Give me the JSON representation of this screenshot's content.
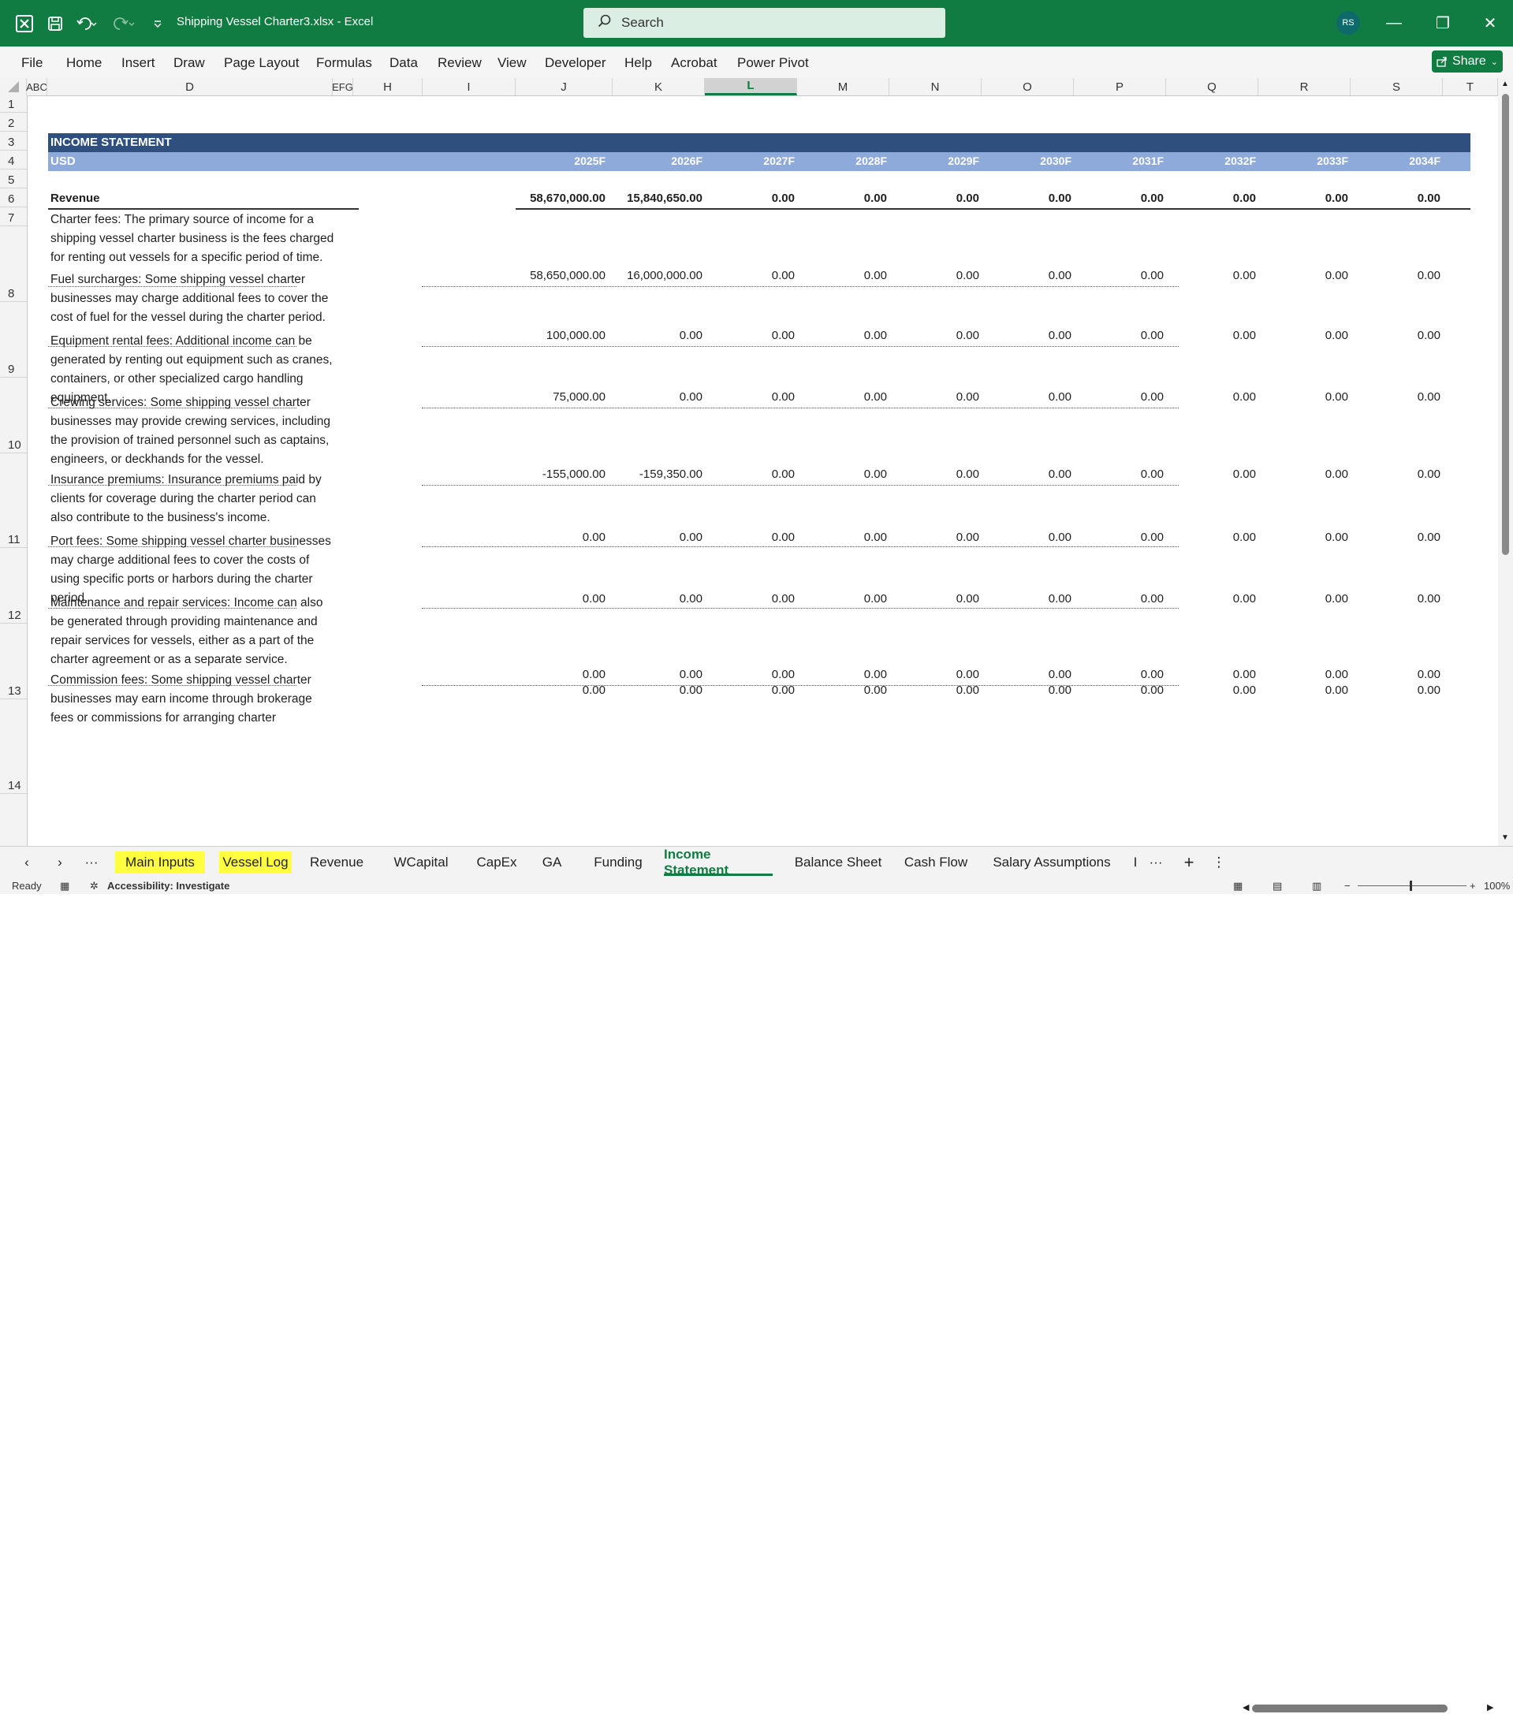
{
  "titlebar": {
    "doc_title": "Shipping Vessel Charter3.xlsx  -  Excel",
    "search_placeholder": "Search",
    "avatar": "RS",
    "minimize": "—",
    "restore": "❐",
    "close": "✕"
  },
  "menu": [
    "File",
    "Home",
    "Insert",
    "Draw",
    "Page Layout",
    "Formulas",
    "Data",
    "Review",
    "View",
    "Developer",
    "Help",
    "Acrobat",
    "Power Pivot"
  ],
  "share_label": "Share",
  "columns": [
    "ABC",
    "D",
    "EFG",
    "H",
    "I",
    "J",
    "K",
    "L",
    "M",
    "N",
    "O",
    "P",
    "Q",
    "R",
    "S",
    "T"
  ],
  "selected_column": "L",
  "rows": [
    "1",
    "2",
    "3",
    "4",
    "5",
    "6",
    "7",
    "8",
    "9",
    "10",
    "11",
    "12",
    "13",
    "14"
  ],
  "sheet": {
    "title": "INCOME STATEMENT",
    "currency": "USD",
    "years": [
      "2025F",
      "2026F",
      "2027F",
      "2028F",
      "2029F",
      "2030F",
      "2031F",
      "2032F",
      "2033F",
      "2034F"
    ],
    "revenue_label": "Revenue",
    "revenue_values": [
      "58,670,000.00",
      "15,840,650.00",
      "0.00",
      "0.00",
      "0.00",
      "0.00",
      "0.00",
      "0.00",
      "0.00",
      "0.00"
    ],
    "lines": [
      {
        "desc": "Charter fees: The primary source of income for a shipping vessel charter business is the fees charged for renting out vessels for a specific period of time.",
        "values": [
          "58,650,000.00",
          "16,000,000.00",
          "0.00",
          "0.00",
          "0.00",
          "0.00",
          "0.00",
          "0.00",
          "0.00",
          "0.00"
        ]
      },
      {
        "desc": "Fuel surcharges: Some shipping vessel charter businesses may charge additional fees to cover the cost of fuel for the vessel during the charter period.",
        "values": [
          "100,000.00",
          "0.00",
          "0.00",
          "0.00",
          "0.00",
          "0.00",
          "0.00",
          "0.00",
          "0.00",
          "0.00"
        ]
      },
      {
        "desc": "Equipment rental fees: Additional income can be generated by renting out equipment such as cranes, containers, or other specialized cargo handling equipment.",
        "values": [
          "75,000.00",
          "0.00",
          "0.00",
          "0.00",
          "0.00",
          "0.00",
          "0.00",
          "0.00",
          "0.00",
          "0.00"
        ]
      },
      {
        "desc": "Crewing services: Some shipping vessel charter businesses may provide crewing services, including the provision of trained personnel such as captains, engineers, or deckhands for the vessel.",
        "values": [
          "-155,000.00",
          "-159,350.00",
          "0.00",
          "0.00",
          "0.00",
          "0.00",
          "0.00",
          "0.00",
          "0.00",
          "0.00"
        ]
      },
      {
        "desc": "Insurance premiums: Insurance premiums paid by clients for coverage during the charter period can also contribute to the business's income.",
        "values": [
          "0.00",
          "0.00",
          "0.00",
          "0.00",
          "0.00",
          "0.00",
          "0.00",
          "0.00",
          "0.00",
          "0.00"
        ]
      },
      {
        "desc": "Port fees: Some shipping vessel charter businesses may charge additional fees to cover the costs of using specific ports or harbors during the charter period.",
        "values": [
          "0.00",
          "0.00",
          "0.00",
          "0.00",
          "0.00",
          "0.00",
          "0.00",
          "0.00",
          "0.00",
          "0.00"
        ]
      },
      {
        "desc": "Maintenance and repair services: Income can also be generated through providing maintenance and repair services for vessels, either as a part of the charter agreement or as a separate service.",
        "values": [
          "0.00",
          "0.00",
          "0.00",
          "0.00",
          "0.00",
          "0.00",
          "0.00",
          "0.00",
          "0.00",
          "0.00"
        ]
      },
      {
        "desc": "Commission fees: Some shipping vessel charter businesses may earn income through brokerage fees or commissions for arranging charter",
        "values": [
          "0.00",
          "0.00",
          "0.00",
          "0.00",
          "0.00",
          "0.00",
          "0.00",
          "0.00",
          "0.00",
          "0.00"
        ]
      }
    ]
  },
  "tabs": [
    {
      "label": "Main Inputs",
      "style": "yellow"
    },
    {
      "label": "Vessel Log",
      "style": "yellow"
    },
    {
      "label": "Revenue",
      "style": ""
    },
    {
      "label": "WCapital",
      "style": ""
    },
    {
      "label": "CapEx",
      "style": ""
    },
    {
      "label": "GA",
      "style": ""
    },
    {
      "label": "Funding",
      "style": ""
    },
    {
      "label": "Income Statement",
      "style": "active"
    },
    {
      "label": "Balance Sheet",
      "style": ""
    },
    {
      "label": "Cash Flow",
      "style": ""
    },
    {
      "label": "Salary Assumptions",
      "style": ""
    },
    {
      "label": "I",
      "style": ""
    }
  ],
  "status": {
    "ready": "Ready",
    "accessibility": "Accessibility: Investigate",
    "zoom": "100%"
  }
}
